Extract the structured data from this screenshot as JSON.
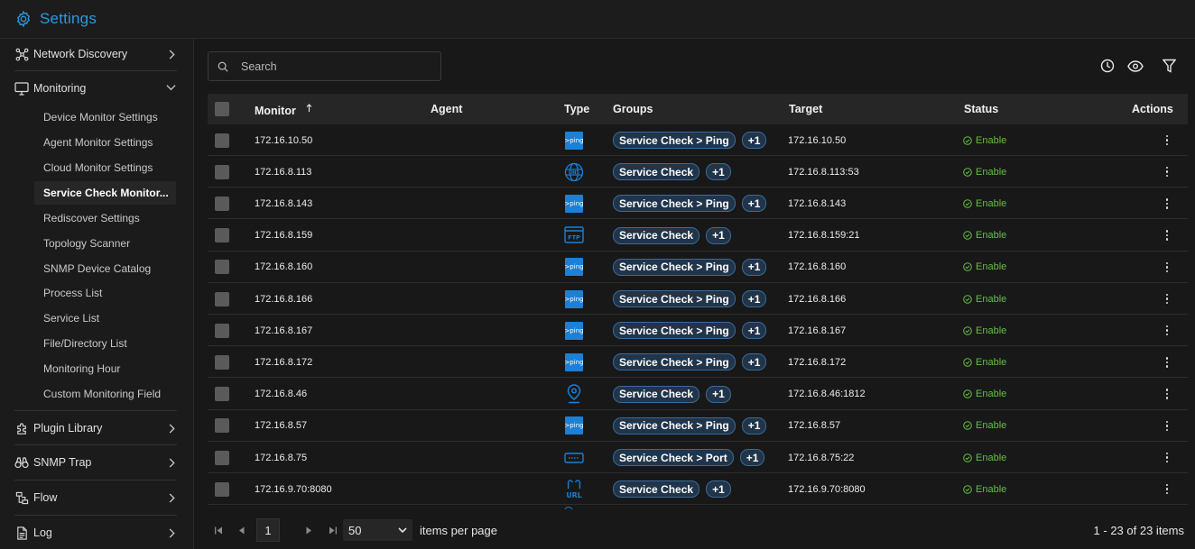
{
  "header": {
    "title": "Settings"
  },
  "sidebar": {
    "groups": {
      "network_discovery": "Network Discovery",
      "monitoring": "Monitoring",
      "plugin_library": "Plugin Library",
      "snmp_trap": "SNMP Trap",
      "flow": "Flow",
      "log": "Log"
    },
    "monitoring_items": [
      "Device Monitor Settings",
      "Agent Monitor Settings",
      "Cloud Monitor Settings",
      "Service Check Monitor...",
      "Rediscover Settings",
      "Topology Scanner",
      "SNMP Device Catalog",
      "Process List",
      "Service List",
      "File/Directory List",
      "Monitoring Hour",
      "Custom Monitoring Field"
    ],
    "active_index": 3
  },
  "toolbar": {
    "search_placeholder": "Search"
  },
  "table": {
    "headers": {
      "monitor": "Monitor",
      "agent": "Agent",
      "type": "Type",
      "groups": "Groups",
      "target": "Target",
      "status": "Status",
      "actions": "Actions"
    },
    "sort_icon": "arrow-up-icon",
    "rows": [
      {
        "monitor": "172.16.10.50",
        "type_icon": "ping",
        "group": "Service Check > Ping",
        "extra": "+1",
        "target": "172.16.10.50",
        "status": "Enable"
      },
      {
        "monitor": "172.16.8.113",
        "type_icon": "dns",
        "group": "Service Check",
        "extra": "+1",
        "target": "172.16.8.113:53",
        "status": "Enable"
      },
      {
        "monitor": "172.16.8.143",
        "type_icon": "ping",
        "group": "Service Check > Ping",
        "extra": "+1",
        "target": "172.16.8.143",
        "status": "Enable"
      },
      {
        "monitor": "172.16.8.159",
        "type_icon": "ftp",
        "group": "Service Check",
        "extra": "+1",
        "target": "172.16.8.159:21",
        "status": "Enable"
      },
      {
        "monitor": "172.16.8.160",
        "type_icon": "ping",
        "group": "Service Check > Ping",
        "extra": "+1",
        "target": "172.16.8.160",
        "status": "Enable"
      },
      {
        "monitor": "172.16.8.166",
        "type_icon": "ping",
        "group": "Service Check > Ping",
        "extra": "+1",
        "target": "172.16.8.166",
        "status": "Enable"
      },
      {
        "monitor": "172.16.8.167",
        "type_icon": "ping",
        "group": "Service Check > Ping",
        "extra": "+1",
        "target": "172.16.8.167",
        "status": "Enable"
      },
      {
        "monitor": "172.16.8.172",
        "type_icon": "ping",
        "group": "Service Check > Ping",
        "extra": "+1",
        "target": "172.16.8.172",
        "status": "Enable"
      },
      {
        "monitor": "172.16.8.46",
        "type_icon": "location",
        "group": "Service Check",
        "extra": "+1",
        "target": "172.16.8.46:1812",
        "status": "Enable"
      },
      {
        "monitor": "172.16.8.57",
        "type_icon": "ping",
        "group": "Service Check > Ping",
        "extra": "+1",
        "target": "172.16.8.57",
        "status": "Enable"
      },
      {
        "monitor": "172.16.8.75",
        "type_icon": "port",
        "group": "Service Check > Port",
        "extra": "+1",
        "target": "172.16.8.75:22",
        "status": "Enable"
      },
      {
        "monitor": "172.16.9.70:8080",
        "type_icon": "url",
        "group": "Service Check",
        "extra": "+1",
        "target": "172.16.9.70:8080",
        "status": "Enable"
      }
    ]
  },
  "pagination": {
    "page": "1",
    "page_size": "50",
    "items_per_page_label": "items per page",
    "range_info": "1 - 23 of 23 items"
  },
  "colors": {
    "accent": "#2a9be0",
    "status_enable": "#64c041",
    "pill_bg": "#20344a",
    "ping_bg": "#1a80d8"
  }
}
